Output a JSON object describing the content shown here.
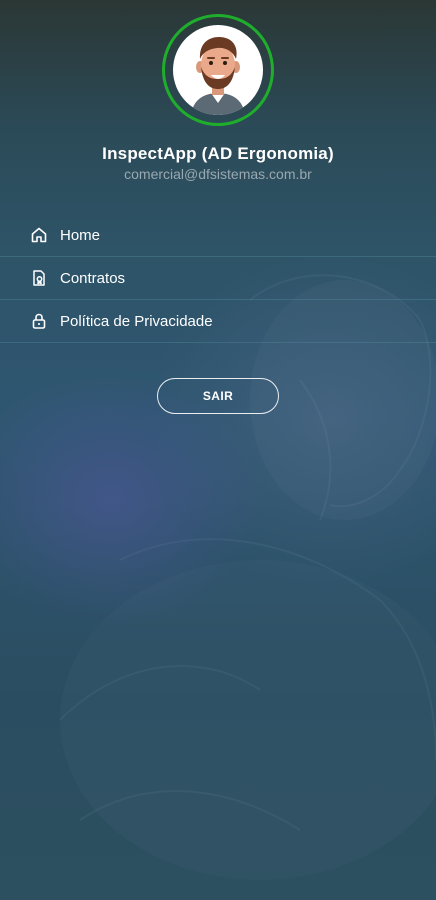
{
  "profile": {
    "name": "InspectApp (AD Ergonomia)",
    "email": "comercial@dfsistemas.com.br",
    "ring_color": "#1fae2c",
    "avatar_icon": "cartoon-man-avatar"
  },
  "menu": {
    "items": [
      {
        "label": "Home",
        "icon": "home-icon"
      },
      {
        "label": "Contratos",
        "icon": "document-icon"
      },
      {
        "label": "Política de Privacidade",
        "icon": "lock-icon"
      }
    ]
  },
  "logout": {
    "label": "SAIR"
  }
}
